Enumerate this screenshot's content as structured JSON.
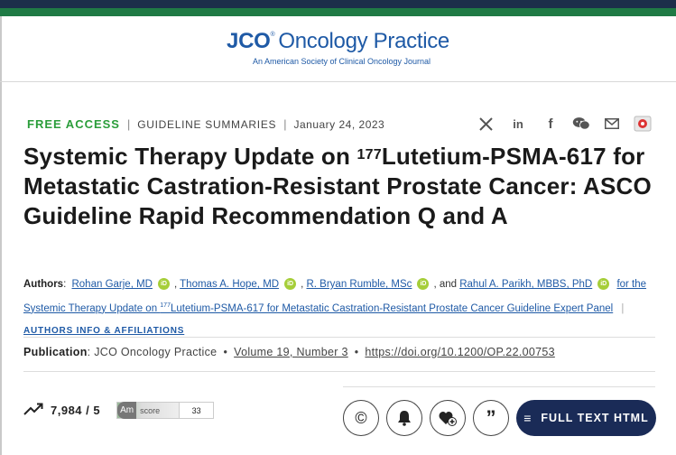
{
  "header": {
    "logo_jco": "JCO",
    "logo_reg": "®",
    "logo_title": "Oncology Practice",
    "logo_subtitle": "An American Society of Clinical Oncology Journal"
  },
  "meta": {
    "access": "FREE ACCESS",
    "category": "GUIDELINE SUMMARIES",
    "date": "January 24, 2023"
  },
  "share": {
    "icons": [
      "x-icon",
      "linkedin-icon",
      "facebook-icon",
      "wechat-icon",
      "email-icon",
      "mendeley-icon"
    ]
  },
  "article": {
    "title_pre": "Systemic Therapy Update on ",
    "title_sup": "177",
    "title_post": "Lutetium-PSMA-617 for Metastatic Castration-Resistant Prostate Cancer: ASCO Guideline Rapid Recommendation Q and A"
  },
  "authors": {
    "label": "Authors",
    "list": [
      "Rohan Garje, MD",
      "Thomas A. Hope, MD",
      "R. Bryan Rumble, MSc",
      "Rahul A. Parikh, MBBS, PhD"
    ],
    "and": "and",
    "panel_pre": "for the Systemic Therapy Update on ",
    "panel_sup": "177",
    "panel_post": "Lutetium-PSMA-617 for Metastatic Castration-Resistant Prostate Cancer Guideline Expert Panel",
    "info_link": "AUTHORS INFO & AFFILIATIONS"
  },
  "publication": {
    "label": "Publication",
    "journal": "JCO Oncology Practice",
    "volume": "Volume 19, Number 3",
    "doi": "https://doi.org/10.1200/OP.22.00753"
  },
  "metrics": {
    "views": "7,984 / 5",
    "altmetric_am": "Am",
    "altmetric_label": "score",
    "altmetric_score": "33"
  },
  "actions": {
    "full_text": "FULL TEXT HTML"
  }
}
